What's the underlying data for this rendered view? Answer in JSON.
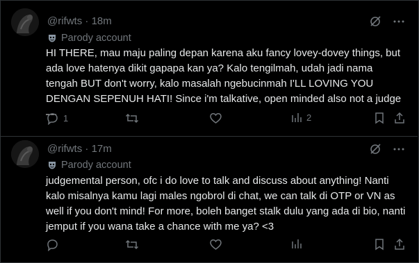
{
  "posts": [
    {
      "handle": "@rifwts",
      "separator": "·",
      "time": "18m",
      "badge": "Parody account",
      "text": "HI THERE, mau maju paling depan karena aku fancy lovey-dovey things, but ada love hatenya dikit gapapa kan ya? Kalo tengilmah, udah jadi nama tengah BUT don't worry, kalo masalah ngebucinmah I'LL LOVING YOU DENGAN SEPENUH HATI! Since i'm talkative, open minded also not a judge —",
      "reply_count": "1",
      "repost_count": "",
      "like_count": "",
      "views_count": "2"
    },
    {
      "handle": "@rifwts",
      "separator": "·",
      "time": "17m",
      "badge": "Parody account",
      "text": "judgemental person, ofc i do love to talk and discuss about anything! Nanti kalo misalnya kamu lagi males ngobrol di chat, we can talk di OTP or VN as well if you don't mind! For more, boleh banget stalk dulu yang ada di bio, nanti jemput if you wana take a chance with me ya? <3",
      "reply_count": "",
      "repost_count": "",
      "like_count": "",
      "views_count": ""
    }
  ],
  "icons": {
    "mask": "parody-mask-icon",
    "hide": "grok-slash-icon",
    "more": "more-dots-icon",
    "reply": "reply-icon",
    "repost": "repost-icon",
    "like": "heart-icon",
    "views": "views-bar-icon",
    "bookmark": "bookmark-icon",
    "share": "share-icon"
  },
  "colors": {
    "background": "#000000",
    "text": "#e7e9ea",
    "muted": "#71767b",
    "border": "#2f3336"
  }
}
